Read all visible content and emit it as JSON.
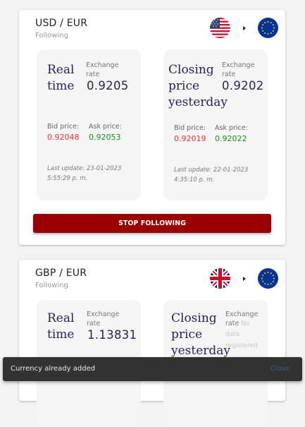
{
  "cards": [
    {
      "pair": "USD / EUR",
      "status": "Following",
      "from_flag": "us-flag-icon",
      "to_flag": "eu-flag-icon",
      "realtime": {
        "title_line1": "Real",
        "title_line2": "time",
        "rate_label_line1": "Exchange",
        "rate_label_line2": "rate",
        "rate": "0.9205",
        "bid_label": "Bid price:",
        "bid": "0.92048",
        "ask_label": "Ask price:",
        "ask": "0.92053",
        "update_line1": "Last update: 23-01-2023",
        "update_line2": "5:55:29 p. m."
      },
      "closing": {
        "title_line1": "Closing",
        "title_line2": "price",
        "title_line3": "yesterday",
        "rate_label_line1": "Exchange",
        "rate_label_line2": "rate",
        "rate": "0.9202",
        "bid_label": "Bid price:",
        "bid": "0.92019",
        "ask_label": "Ask price:",
        "ask": "0.92022",
        "update_line1": "Last update: 22-01-2023",
        "update_line2": "4:35:10 p. m."
      },
      "button_label": "STOP FOLLOWING"
    },
    {
      "pair": "GBP / EUR",
      "status": "Following",
      "from_flag": "uk-flag-icon",
      "to_flag": "eu-flag-icon",
      "realtime": {
        "title_line1": "Real",
        "title_line2": "time",
        "rate_label_line1": "Exchange",
        "rate_label_line2": "rate",
        "rate": "1.13831"
      },
      "closing": {
        "title_line1": "Closing",
        "title_line2": "price",
        "title_line3": "yesterday",
        "rate_label_line1": "Exchange",
        "rate_label_line2": "rate",
        "no_data_1": "No",
        "no_data_2": "data",
        "no_data_3": "registered"
      }
    }
  ],
  "snackbar": {
    "message": "Currency already added",
    "action": "Close"
  },
  "colors": {
    "button": "#990000",
    "bid": "#e0332d",
    "ask": "#1e8a1e",
    "title": "#1f2552"
  }
}
